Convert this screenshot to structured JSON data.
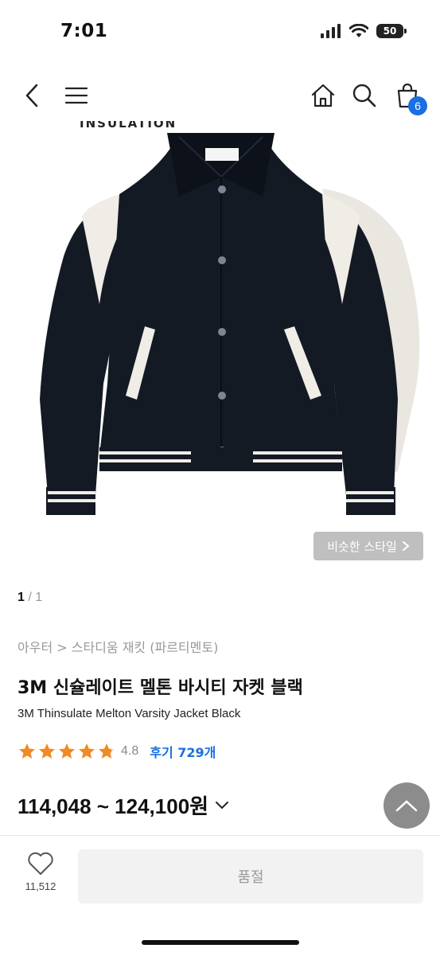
{
  "status": {
    "time": "7:01",
    "battery": "50"
  },
  "nav": {
    "cart_count": "6"
  },
  "image": {
    "insulation_text": "INSULATION"
  },
  "similar_style": {
    "label": "비슷한 스타일"
  },
  "pager": {
    "current": "1",
    "separator": " / ",
    "total": "1"
  },
  "breadcrumb": "아우터 > 스타디움 재킷 (파르티멘토)",
  "product": {
    "title_ko": "3M 신슐레이트 멜톤 바시티 자켓 블랙",
    "title_en": "3M Thinsulate Melton Varsity Jacket Black",
    "rating": "4.8",
    "rating_value": 4.8,
    "reviews": "후기 729개",
    "price_range": "114,048 ~ 124,100",
    "price_unit": "원"
  },
  "bottom": {
    "like_count": "11,512",
    "soldout_label": "품절"
  },
  "colors": {
    "accent": "#1b6fe0",
    "star": "#f08a24",
    "jacket": "#141a24"
  }
}
